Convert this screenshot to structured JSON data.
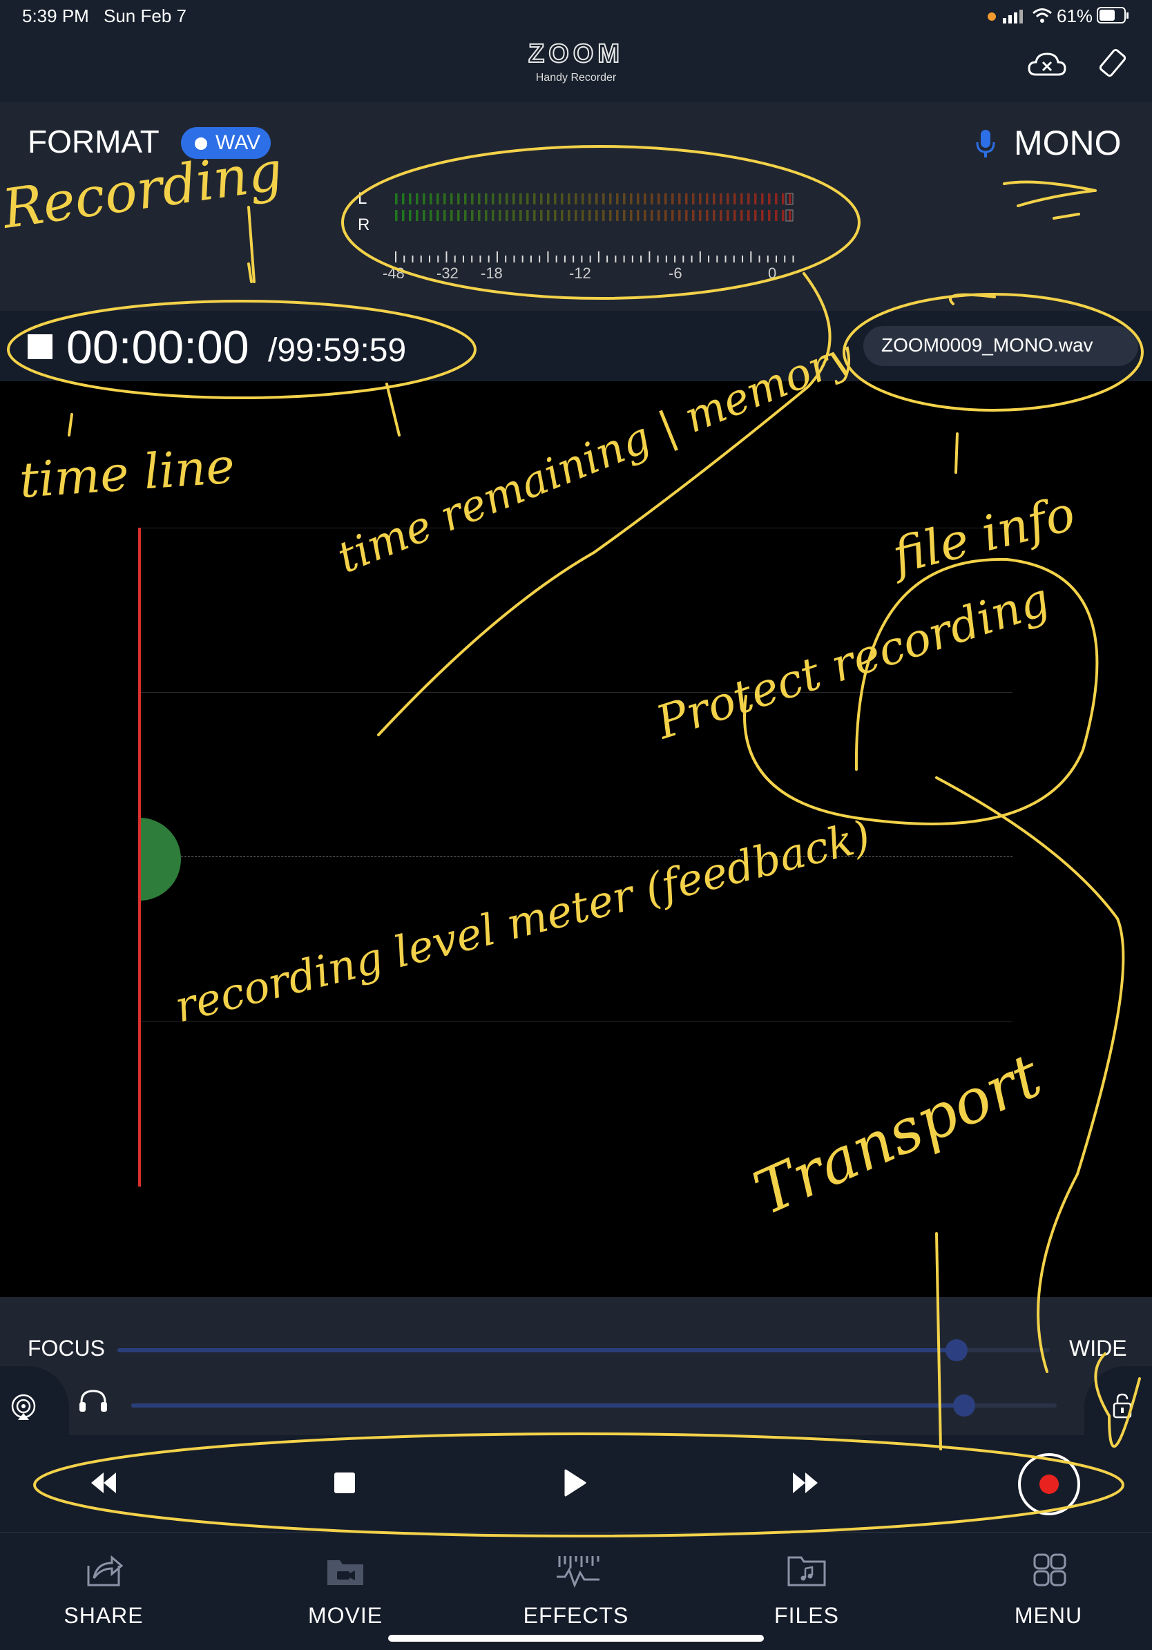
{
  "status_bar": {
    "time": "5:39 PM",
    "date": "Sun Feb 7",
    "battery": "61%"
  },
  "app": {
    "logo": "ZOOM",
    "subtitle": "Handy Recorder"
  },
  "format": {
    "label": "FORMAT",
    "badge": "WAV",
    "channel_mode": "MONO"
  },
  "meter": {
    "channels": [
      "L",
      "R"
    ],
    "scale_labels": [
      "-48",
      "-32",
      "-18",
      "-12",
      "-6",
      "0"
    ]
  },
  "timer": {
    "elapsed": "00:00:00",
    "remaining": "/99:59:59"
  },
  "file": {
    "name": "ZOOM0009_MONO.wav"
  },
  "mic_sliders": {
    "left_label": "FOCUS",
    "right_label": "WIDE",
    "focus_wide_level": 0.9,
    "headphone_level": 0.9
  },
  "tabs": [
    {
      "label": "SHARE",
      "icon": "share-icon"
    },
    {
      "label": "MOVIE",
      "icon": "movie-icon"
    },
    {
      "label": "EFFECTS",
      "icon": "effects-icon"
    },
    {
      "label": "FILES",
      "icon": "files-icon"
    },
    {
      "label": "MENU",
      "icon": "menu-icon"
    }
  ],
  "annotations": [
    "Recording",
    "time line",
    "time remaining | memory",
    "file info",
    "Protect recording",
    "recording level meter (feedback)",
    "Transport"
  ],
  "colors": {
    "accent": "#2d6fe6",
    "record": "#e8231f",
    "playhead": "#d9302c",
    "level": "#2f7d3a",
    "annotation": "#f3d24a"
  }
}
